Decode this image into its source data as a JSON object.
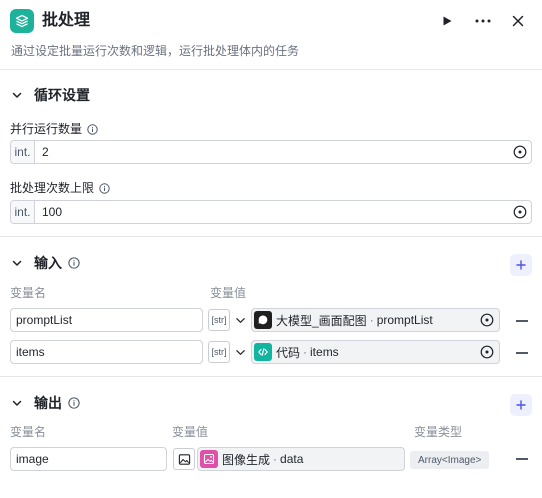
{
  "header": {
    "title": "批处理",
    "subtitle": "通过设定批量运行次数和逻辑，运行批处理体内的任务",
    "icons": {
      "app": "batch-layers-icon",
      "run": "play-icon",
      "more": "more-icon",
      "close": "close-icon"
    }
  },
  "loop_settings": {
    "title": "循环设置",
    "parallel": {
      "label": "并行运行数量",
      "type_prefix": "int.",
      "value": "2"
    },
    "limit": {
      "label": "批处理次数上限",
      "type_prefix": "int.",
      "value": "100"
    }
  },
  "inputs": {
    "title": "输入",
    "col_name": "变量名",
    "col_value": "变量值",
    "rows": [
      {
        "name": "promptList",
        "type_badge": "[str]",
        "ref_node": "大模型_画面配图",
        "ref_var": "promptList",
        "ref_icon": "llm-icon"
      },
      {
        "name": "items",
        "type_badge": "[str]",
        "ref_node": "代码",
        "ref_var": "items",
        "ref_icon": "code-icon"
      }
    ]
  },
  "outputs": {
    "title": "输出",
    "col_name": "变量名",
    "col_value": "变量值",
    "col_type": "变量类型",
    "rows": [
      {
        "name": "image",
        "ref_node": "图像生成",
        "ref_var": "data",
        "type": "Array<Image>",
        "ref_icon": "image-gen-icon"
      }
    ]
  },
  "colors": {
    "brand": "#1db39b",
    "accent": "#4d53e8",
    "code_icon": "#12b5a0",
    "image_icon": "#e04fa8",
    "llm_icon": "#1f1f1f"
  }
}
